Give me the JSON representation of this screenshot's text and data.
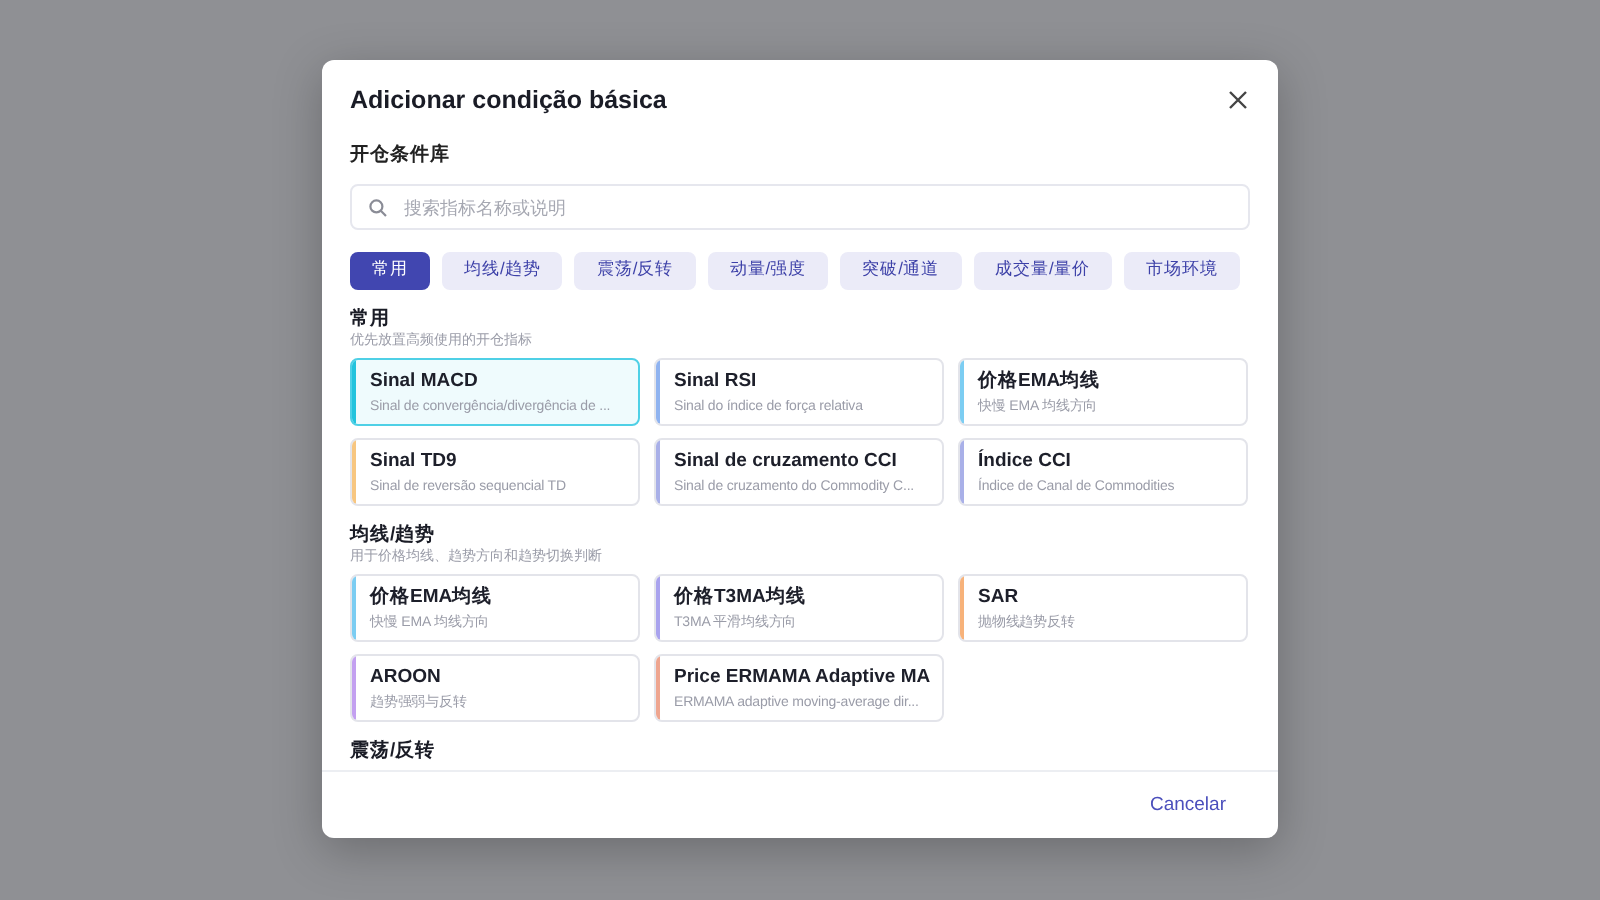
{
  "dialog": {
    "title": "Adicionar condição básica",
    "library_title": "开仓条件库",
    "search": {
      "placeholder": "搜索指标名称或说明"
    },
    "filters": [
      {
        "label": "常用",
        "selected": true
      },
      {
        "label": "均线/趋势",
        "selected": false
      },
      {
        "label": "震荡/反转",
        "selected": false
      },
      {
        "label": "动量/强度",
        "selected": false
      },
      {
        "label": "突破/通道",
        "selected": false
      },
      {
        "label": "成交量/量价",
        "selected": false
      },
      {
        "label": "市场环境",
        "selected": false
      }
    ],
    "sections": [
      {
        "title": "常用",
        "subtitle": "优先放置高频使用的开仓指标",
        "cards": [
          {
            "name": "Sinal MACD",
            "description": "Sinal de convergência/divergência de ...",
            "color": "#22c3dd",
            "selected": true
          },
          {
            "name": "Sinal RSI",
            "description": "Sinal do índice de força relativa",
            "color": "#8fb3f0",
            "selected": false
          },
          {
            "name": "价格EMA均线",
            "description": "快慢 EMA 均线方向",
            "color": "#7ccdf2",
            "selected": false
          },
          {
            "name": "Sinal TD9",
            "description": "Sinal de reversão sequencial TD",
            "color": "#f7c680",
            "selected": false
          },
          {
            "name": "Sinal de cruzamento CCI",
            "description": "Sinal de cruzamento do Commodity C...",
            "color": "#a9b0e8",
            "selected": false
          },
          {
            "name": "Índice CCI",
            "description": "Índice de Canal de Commodities",
            "color": "#a9b0e8",
            "selected": false
          }
        ]
      },
      {
        "title": "均线/趋势",
        "subtitle": "用于价格均线、趋势方向和趋势切换判断",
        "cards": [
          {
            "name": "价格EMA均线",
            "description": "快慢 EMA 均线方向",
            "color": "#7ccdf2",
            "selected": false
          },
          {
            "name": "价格T3MA均线",
            "description": "T3MA 平滑均线方向",
            "color": "#a9a3ee",
            "selected": false
          },
          {
            "name": "SAR",
            "description": "抛物线趋势反转",
            "color": "#f7b27a",
            "selected": false
          },
          {
            "name": "AROON",
            "description": "趋势强弱与反转",
            "color": "#c3a0f0",
            "selected": false
          },
          {
            "name": "Price ERMAMA Adaptive MA",
            "description": "ERMAMA adaptive moving-average dir...",
            "color": "#eea58f",
            "selected": false
          }
        ]
      },
      {
        "title": "震荡/反转"
      }
    ],
    "cancel_button": "Cancelar"
  }
}
